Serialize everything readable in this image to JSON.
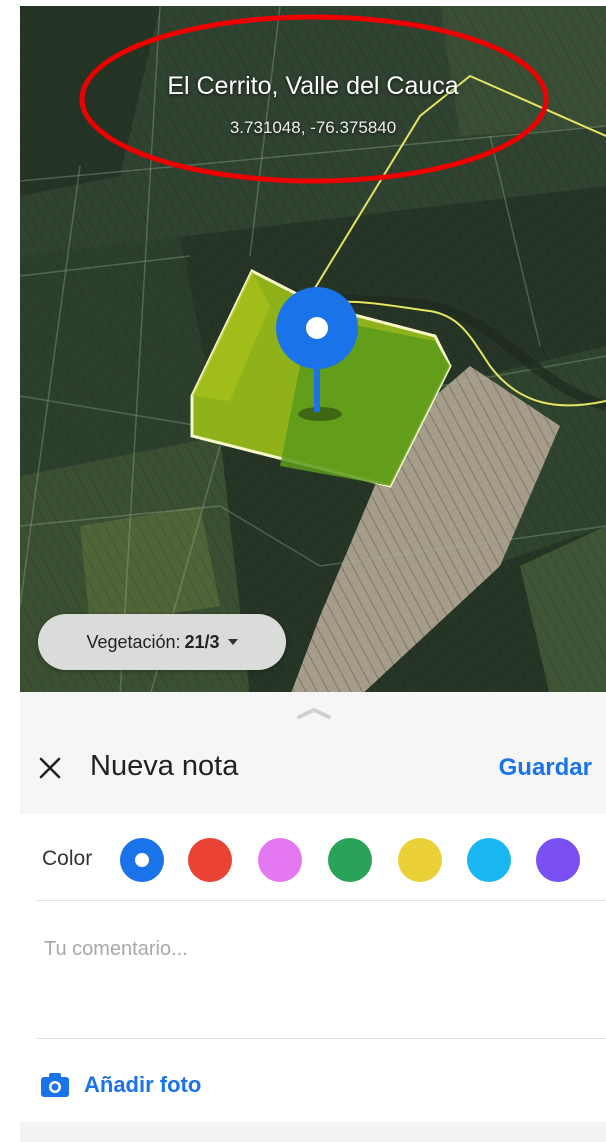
{
  "location": {
    "name": "El Cerrito, Valle del Cauca",
    "coordinates": "3.731048, -76.375840"
  },
  "vegetation": {
    "label": "Vegetación:",
    "date": "21/3"
  },
  "note": {
    "title": "Nueva nota",
    "save_label": "Guardar",
    "color_label": "Color",
    "colors": [
      "#1a73e8",
      "#ea4335",
      "#e378f0",
      "#2aa35a",
      "#ecd037",
      "#1ab6f2",
      "#7a50f2"
    ],
    "selected_color_index": 0,
    "comment_placeholder": "Tu comentario...",
    "comment_value": "",
    "add_photo_label": "Añadir foto"
  },
  "icons": {
    "close": "close-icon",
    "camera": "camera-icon",
    "pin": "map-pin-icon",
    "handle": "chevron-up-icon",
    "dropdown": "caret-down-icon"
  },
  "accent_color": "#1a73e8"
}
